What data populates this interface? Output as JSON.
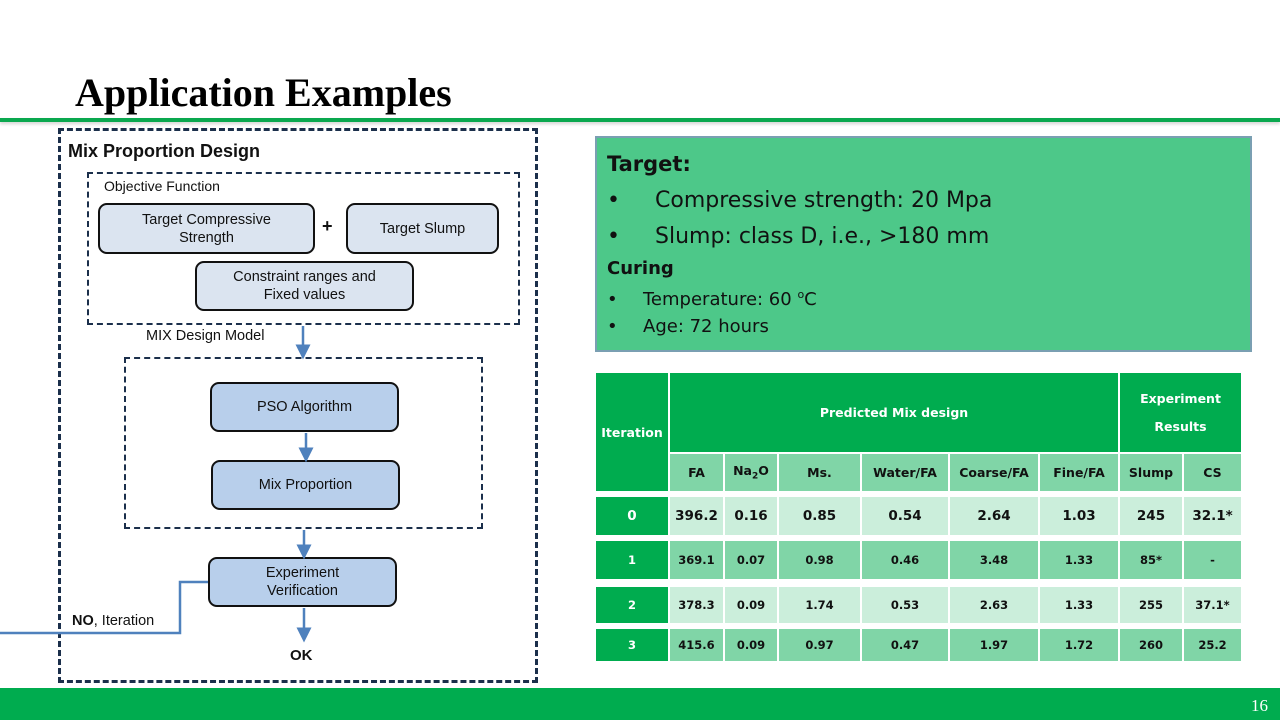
{
  "slide": {
    "title": "Application Examples",
    "page_number": "16"
  },
  "diagram": {
    "title": "Mix Proportion Design",
    "objective_label": "Objective Function",
    "nodes": {
      "target_cs": "Target Compressive Strength",
      "plus": "+",
      "target_slump": "Target Slump",
      "constraints": "Constraint ranges and Fixed values",
      "pso": "PSO Algorithm",
      "mix_proportion": "Mix Proportion",
      "experiment": "Experiment Verification"
    },
    "model_label": "MIX Design Model",
    "no_label_bold": "NO",
    "no_label_rest": ", Iteration",
    "ok_label": "OK"
  },
  "target_box": {
    "heading": "Target:",
    "bullet": "•",
    "targets": [
      "Compressive strength: 20 Mpa",
      "Slump: class D, i.e.,  >180 mm"
    ],
    "curing_heading": "Curing",
    "curing_temp_prefix": "Temperature: 60 ",
    "curing_temp_deg": "o",
    "curing_temp_unit": "C",
    "curing_age": "Age: 72 hours"
  },
  "table": {
    "header_iteration": "Iteration",
    "header_predicted": "Predicted Mix design",
    "header_experiment": "Experiment Results",
    "columns": [
      "FA",
      "Na2O",
      "Ms.",
      "Water/FA",
      "Coarse/FA",
      "Fine/FA",
      "Slump",
      "CS"
    ],
    "na2o_main": "Na",
    "na2o_sub": "2",
    "na2o_tail": "O",
    "rows": [
      {
        "iteration": "0",
        "values": [
          "396.2",
          "0.16",
          "0.85",
          "0.54",
          "2.64",
          "1.03",
          "245",
          "32.1*"
        ]
      },
      {
        "iteration": "1",
        "values": [
          "369.1",
          "0.07",
          "0.98",
          "0.46",
          "3.48",
          "1.33",
          "85*",
          "-"
        ]
      },
      {
        "iteration": "2",
        "values": [
          "378.3",
          "0.09",
          "1.74",
          "0.53",
          "2.63",
          "1.33",
          "255",
          "37.1*"
        ]
      },
      {
        "iteration": "3",
        "values": [
          "415.6",
          "0.09",
          "0.97",
          "0.47",
          "1.97",
          "1.72",
          "260",
          "25.2"
        ]
      }
    ]
  },
  "colors": {
    "brand_green": "#00ac4f",
    "target_box_fill": "#4dc889",
    "cell_light": "#cbeedb",
    "cell_mid": "#80d5a7",
    "node_blue": "#b8cfeb",
    "connector_blue": "#4f81bd",
    "frame_navy": "#1b2f4b"
  }
}
